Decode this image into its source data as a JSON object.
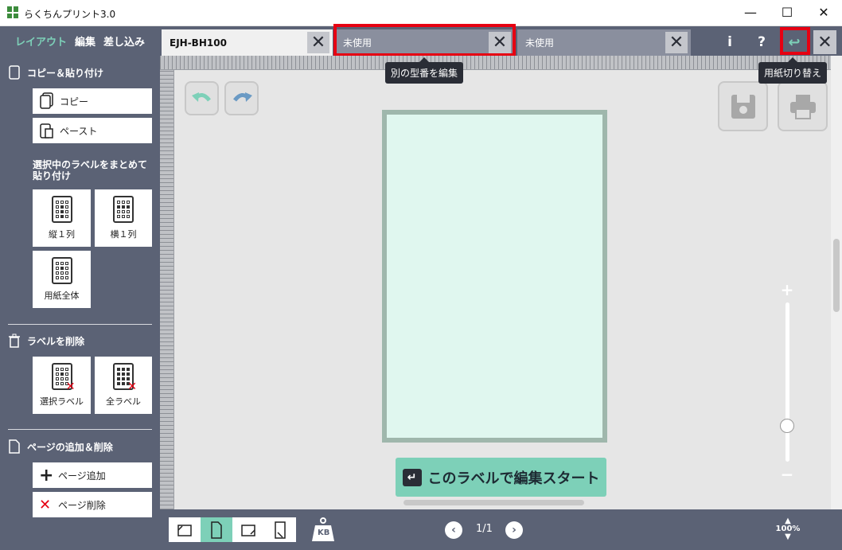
{
  "window": {
    "title": "らくちんプリント3.0",
    "minimize": "—",
    "maximize": "☐",
    "close": "✕"
  },
  "nav": {
    "layout": "レイアウト",
    "edit": "編集",
    "merge": "差し込み"
  },
  "tabs": [
    {
      "label": "EJH-BH100",
      "close": "✕"
    },
    {
      "label": "未使用",
      "close": "✕"
    },
    {
      "label": "未使用",
      "close": "✕"
    }
  ],
  "toolbar": {
    "info": "i",
    "help": "?",
    "switch_icon": "↩",
    "close": "✕"
  },
  "tooltips": {
    "tab_edit": "別の型番を編集",
    "paper_switch": "用紙切り替え"
  },
  "sidebar": {
    "copy_paste": {
      "heading": "コピー＆貼り付け",
      "copy": "コピー",
      "paste": "ペースト"
    },
    "bulk_paste": {
      "heading": "選択中のラベルをまとめて貼り付け",
      "column": "縦１列",
      "row": "横１列",
      "all_sheet": "用紙全体"
    },
    "delete": {
      "heading": "ラベルを削除",
      "selected": "選択ラベル",
      "all": "全ラベル"
    },
    "page": {
      "heading": "ページの追加＆削除",
      "add": "ページ追加",
      "remove": "ページ削除"
    }
  },
  "canvas": {
    "start_button": "このラベルで編集スタート"
  },
  "zoom": {
    "plus": "+",
    "minus": "−",
    "level": "100%",
    "slider_fraction": 0.2
  },
  "pager": {
    "text": "1/1",
    "prev": "‹",
    "next": "›"
  },
  "weight": {
    "label": "KB"
  },
  "colors": {
    "accent": "#7dd0b8",
    "panel": "#5b6275",
    "highlight": "#e60012",
    "paper": "#e0f7ef"
  }
}
